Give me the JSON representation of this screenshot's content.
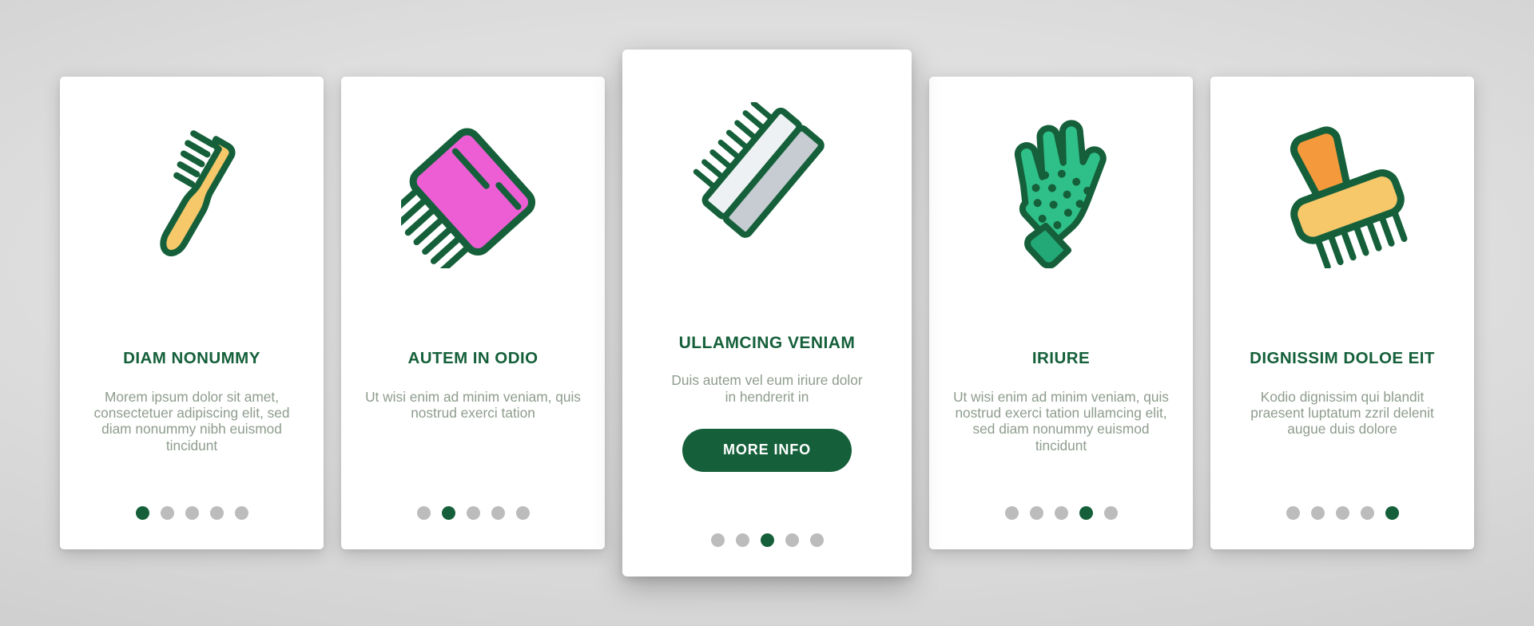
{
  "theme": {
    "background": "#d6d6d6",
    "card_background": "#ffffff",
    "accent_green": "#15603a",
    "body_text": "#8e9c8e",
    "dot_inactive": "#bcbcbc",
    "dot_active": "#15603a"
  },
  "cards": [
    {
      "icon": "toothbrush-icon",
      "icon_colors": {
        "body": "#f6c86a",
        "outline": "#15603a"
      },
      "title": "DIAM NONUMMY",
      "description": "Morem ipsum dolor sit amet, consectetuer adipiscing elit, sed diam nonummy nibh euismod tincidunt",
      "dots": {
        "count": 5,
        "active_index": 0
      },
      "featured": false
    },
    {
      "icon": "comb-icon",
      "icon_colors": {
        "body": "#ed5ed5",
        "outline": "#15603a"
      },
      "title": "AUTEM IN ODIO",
      "description": "Ut wisi enim ad minim veniam, quis nostrud exerci tation",
      "dots": {
        "count": 5,
        "active_index": 1
      },
      "featured": false
    },
    {
      "icon": "slicker-brush-icon",
      "icon_colors": {
        "body": "#c6ccd2",
        "outline": "#15603a"
      },
      "title": "ULLAMCING VENIAM",
      "description": "Duis autem vel eum iriure dolor in hendrerit in",
      "button_label": "MORE INFO",
      "dots": {
        "count": 5,
        "active_index": 2
      },
      "featured": true
    },
    {
      "icon": "grooming-glove-icon",
      "icon_colors": {
        "body": "#2fc08a",
        "outline": "#15603a"
      },
      "title": "IRIURE",
      "description": "Ut wisi enim ad minim veniam, quis nostrud exerci tation ullamcing elit, sed diam nonummy euismod tincidunt",
      "dots": {
        "count": 5,
        "active_index": 3
      },
      "featured": false
    },
    {
      "icon": "rake-brush-icon",
      "icon_colors": {
        "body": "#f6c86a",
        "handle": "#f59a3c",
        "outline": "#15603a"
      },
      "title": "DIGNISSIM DOLOE EIT",
      "description": "Kodio dignissim qui blandit praesent luptatum zzril delenit augue duis dolore",
      "dots": {
        "count": 5,
        "active_index": 4
      },
      "featured": false
    }
  ]
}
